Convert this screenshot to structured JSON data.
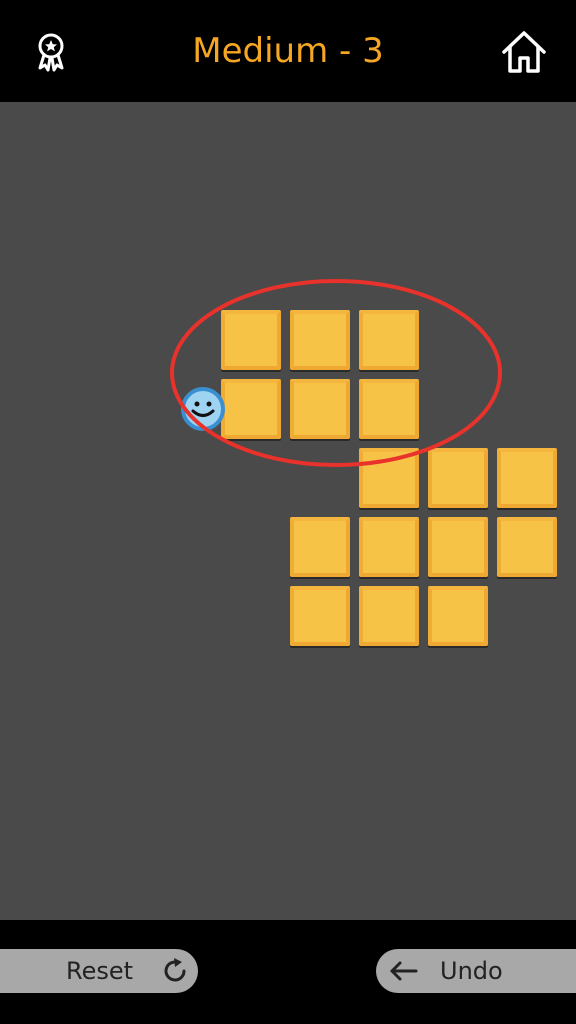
{
  "header": {
    "title": "Medium - 3",
    "left_icon": "award-ribbon-icon",
    "right_icon": "home-icon"
  },
  "board": {
    "tiles": [
      {
        "row": 0,
        "col": 0
      },
      {
        "row": 0,
        "col": 1
      },
      {
        "row": 0,
        "col": 2
      },
      {
        "row": 1,
        "col": 0
      },
      {
        "row": 1,
        "col": 1
      },
      {
        "row": 1,
        "col": 2
      },
      {
        "row": 2,
        "col": 2
      },
      {
        "row": 2,
        "col": 3
      },
      {
        "row": 2,
        "col": 4
      },
      {
        "row": 3,
        "col": 1
      },
      {
        "row": 3,
        "col": 2
      },
      {
        "row": 3,
        "col": 3
      },
      {
        "row": 3,
        "col": 4
      },
      {
        "row": 4,
        "col": 1
      },
      {
        "row": 4,
        "col": 2
      },
      {
        "row": 4,
        "col": 3
      }
    ],
    "player": {
      "row": 1,
      "col": -1,
      "icon": "smiley-face-icon"
    },
    "highlight_color": "#E8322B"
  },
  "controls": {
    "reset_label": "Reset",
    "reset_icon": "refresh-icon",
    "undo_label": "Undo",
    "undo_icon": "arrow-left-icon"
  },
  "colors": {
    "accent": "#F5A623",
    "tile": "#F6C347",
    "board_bg": "#4a4a4a"
  }
}
